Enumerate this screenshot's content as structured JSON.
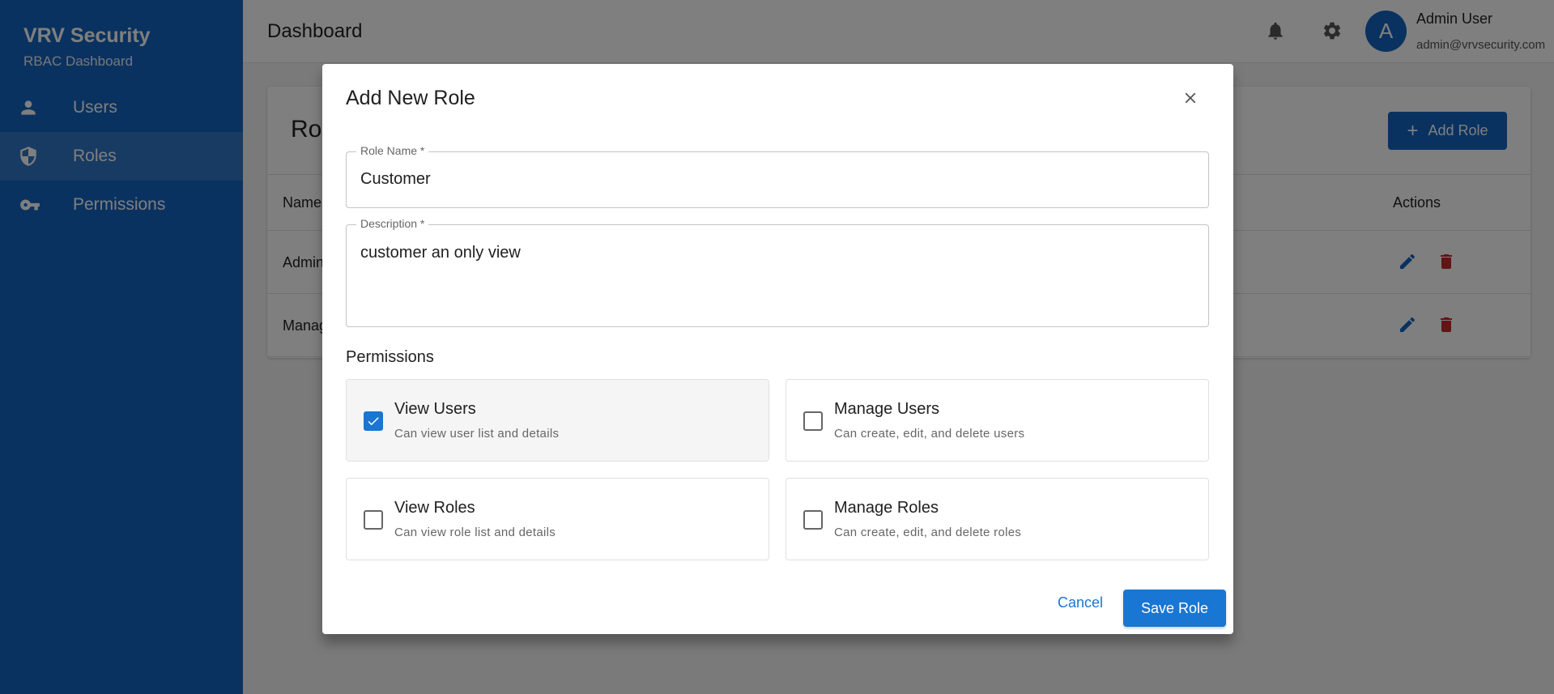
{
  "sidebar": {
    "brand_title": "VRV Security",
    "brand_subtitle": "RBAC Dashboard",
    "items": [
      {
        "label": "Users",
        "icon": "person-icon"
      },
      {
        "label": "Roles",
        "icon": "shield-icon",
        "active": true
      },
      {
        "label": "Permissions",
        "icon": "key-icon"
      }
    ]
  },
  "topbar": {
    "title": "Dashboard",
    "avatar_initial": "A",
    "user_name": "Admin User",
    "user_email": "admin@vrvsecurity.com"
  },
  "roles_page": {
    "title": "Roles",
    "add_button": "Add Role",
    "columns": {
      "name": "Name",
      "actions": "Actions"
    },
    "rows": [
      {
        "name": "Admin"
      },
      {
        "name": "Manager"
      }
    ]
  },
  "dialog": {
    "title": "Add New Role",
    "role_name_label": "Role Name *",
    "role_name_value": "Customer",
    "description_label": "Description *",
    "description_value": "customer an only view",
    "permissions_heading": "Permissions",
    "permissions": [
      {
        "title": "View Users",
        "description": "Can view user list and details",
        "checked": true
      },
      {
        "title": "Manage Users",
        "description": "Can create, edit, and delete users",
        "checked": false
      },
      {
        "title": "View Roles",
        "description": "Can view role list and details",
        "checked": false
      },
      {
        "title": "Manage Roles",
        "description": "Can create, edit, and delete roles",
        "checked": false
      }
    ],
    "cancel_label": "Cancel",
    "save_label": "Save Role"
  },
  "colors": {
    "primary": "#1565c0",
    "button_blue": "#1976d2",
    "delete_red": "#c62828"
  }
}
